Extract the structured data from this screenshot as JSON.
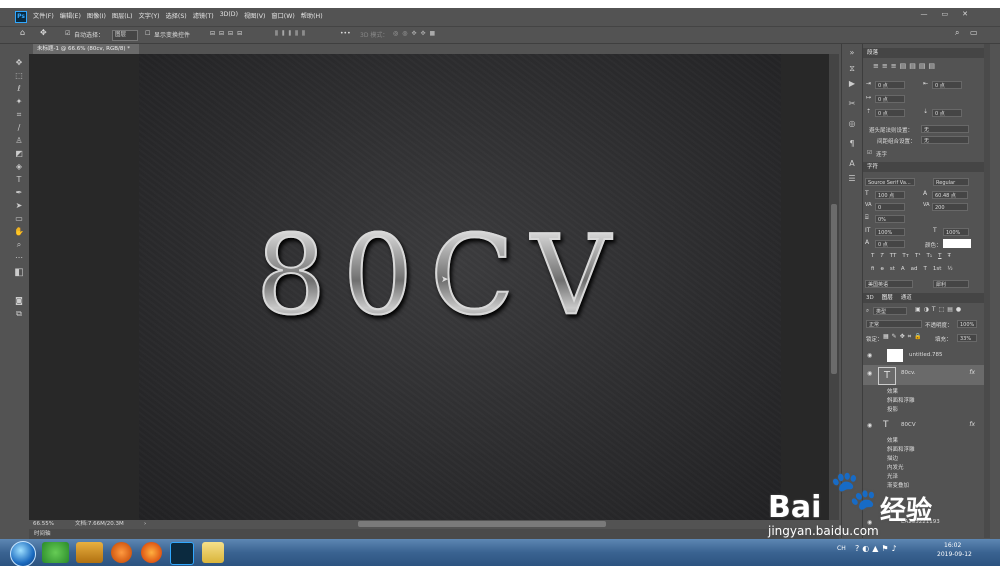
{
  "app": {
    "name": "Ps"
  },
  "menu": [
    "文件(F)",
    "编辑(E)",
    "图像(I)",
    "图层(L)",
    "文字(Y)",
    "选择(S)",
    "滤镜(T)",
    "3D(D)",
    "视图(V)",
    "窗口(W)",
    "帮助(H)"
  ],
  "window_controls": [
    "—",
    "▭",
    "✕"
  ],
  "options": {
    "auto_select_label": "自动选择：",
    "auto_select_value": "图层",
    "show_transform_label": "显示变换控件",
    "mode_label": "3D 模式："
  },
  "document": {
    "tab_title": "未标题-1 @ 66.6% (80cv, RGB/8) *",
    "canvas_text": "80CV"
  },
  "status": {
    "zoom": "66.55%",
    "doc_size": "文档:7.66M/20.3M",
    "timeline": "时间轴"
  },
  "paragraph_panel": {
    "title": "段落",
    "indent_left": "0 点",
    "indent_right": "0 点",
    "indent_first": "0 点",
    "space_before": "0 点",
    "space_after": "0 点",
    "kinsoku_label": "避头尾法则设置：",
    "kinsoku_value": "无",
    "mojikumi_label": "间距组合设置：",
    "mojikumi_value": "无",
    "hyphenate_label": "连字"
  },
  "character_panel": {
    "title": "字符",
    "font_family": "Source Serif Va...",
    "font_style": "Regular",
    "font_size": "100 点",
    "leading": "60.48 点",
    "kerning": "0",
    "tracking": "200",
    "scale_pct": "0%",
    "vscale": "100%",
    "hscale": "100%",
    "baseline": "0 点",
    "color_label": "颜色：",
    "language": "美国英语",
    "antialias": "犀利",
    "style_buttons": [
      "T",
      "T",
      "TT",
      "Tт",
      "T¹",
      "T₁",
      "T",
      "Ŧ"
    ],
    "opentype_buttons": [
      "fi",
      "ɵ",
      "st",
      "A",
      "ad",
      "T",
      "1st",
      "½"
    ]
  },
  "layers_panel": {
    "tabs": [
      "3D",
      "图层",
      "通道"
    ],
    "filter_label": "类型",
    "blend_mode": "正常",
    "opacity_label": "不透明度：",
    "opacity": "100%",
    "lock_label": "锁定：",
    "fill_label": "填充：",
    "fill": "33%",
    "layers": [
      {
        "name": "untitled.785",
        "fx": ""
      },
      {
        "name": "80cv.",
        "fx": "fx",
        "effects_label": "效果",
        "effects": [
          "斜面和浮雕",
          "投影"
        ]
      },
      {
        "name": "80CV",
        "fx": "fx",
        "effects_label": "效果",
        "effects": [
          "斜面和浮雕",
          "描边",
          "内发光",
          "光泽",
          "渐变叠加"
        ]
      },
      {
        "name": "EA235221193",
        "fx": ""
      }
    ]
  },
  "taskbar": {
    "time": "16:02",
    "date": "2019-09-12",
    "tray_label": "CH"
  },
  "watermark": {
    "text": "Bai",
    "text2": "经验",
    "url": "jingyan.baidu.com"
  }
}
